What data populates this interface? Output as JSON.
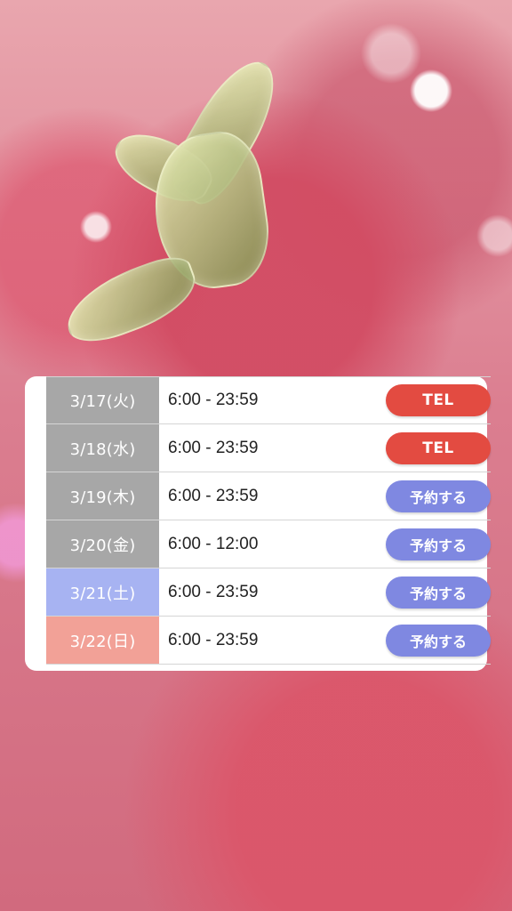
{
  "colors": {
    "weekday_date_bg": "#a7a7a7",
    "saturday_date_bg": "#a7b3f2",
    "sunday_date_bg": "#f2a197",
    "tel_button": "#e34b41",
    "reserve_button": "#7f88e1",
    "panel_bg": "#ffffff"
  },
  "background": {
    "icon": "strawberry-background"
  },
  "schedule": {
    "rows": [
      {
        "date": "3/17(火)",
        "hours": "6:00 - 23:59",
        "action_label": "TEL",
        "action_type": "tel",
        "date_bg": "#a7a7a7"
      },
      {
        "date": "3/18(水)",
        "hours": "6:00 - 23:59",
        "action_label": "TEL",
        "action_type": "tel",
        "date_bg": "#a7a7a7"
      },
      {
        "date": "3/19(木)",
        "hours": "6:00 - 23:59",
        "action_label": "予約する",
        "action_type": "reserve",
        "date_bg": "#a7a7a7"
      },
      {
        "date": "3/20(金)",
        "hours": "6:00 - 12:00",
        "action_label": "予約する",
        "action_type": "reserve",
        "date_bg": "#a7a7a7"
      },
      {
        "date": "3/21(土)",
        "hours": "6:00 - 23:59",
        "action_label": "予約する",
        "action_type": "reserve",
        "date_bg": "#a7b3f2"
      },
      {
        "date": "3/22(日)",
        "hours": "6:00 - 23:59",
        "action_label": "予約する",
        "action_type": "reserve",
        "date_bg": "#f2a197"
      }
    ]
  }
}
